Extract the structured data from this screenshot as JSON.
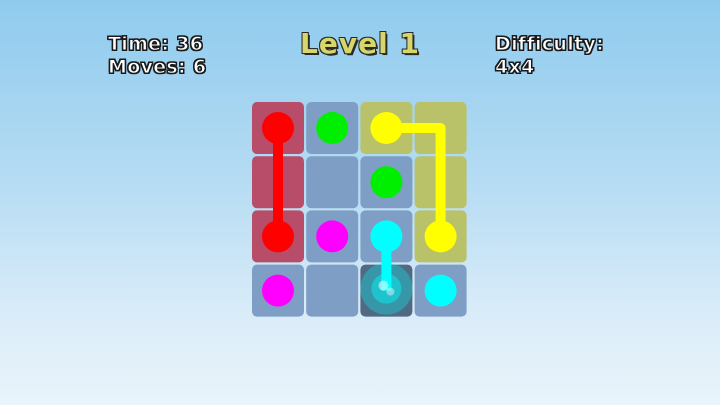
{
  "hud": {
    "time_text": "Time: 36",
    "moves_text": "Moves: 6",
    "level_text": "Level 1",
    "difficulty_label": "Difficulty:",
    "difficulty_value": "4x4"
  },
  "board": {
    "rows": 4,
    "cols": 4,
    "colors": {
      "red": "#ff0000",
      "green": "#00ee00",
      "yellow": "#ffff00",
      "magenta": "#ff00ff",
      "cyan": "#00ffff",
      "empty_cell": "#7f9ec6",
      "selected_cell": "#4f6a82"
    },
    "dots": [
      {
        "color": "red",
        "row": 0,
        "col": 0
      },
      {
        "color": "red",
        "row": 2,
        "col": 0
      },
      {
        "color": "green",
        "row": 0,
        "col": 1
      },
      {
        "color": "green",
        "row": 1,
        "col": 2
      },
      {
        "color": "yellow",
        "row": 0,
        "col": 2
      },
      {
        "color": "yellow",
        "row": 2,
        "col": 3
      },
      {
        "color": "magenta",
        "row": 2,
        "col": 1
      },
      {
        "color": "magenta",
        "row": 3,
        "col": 0
      },
      {
        "color": "cyan",
        "row": 2,
        "col": 2
      },
      {
        "color": "cyan",
        "row": 3,
        "col": 3
      }
    ],
    "paths": [
      {
        "color": "red",
        "cells": [
          [
            0,
            0
          ],
          [
            1,
            0
          ],
          [
            2,
            0
          ]
        ]
      },
      {
        "color": "yellow",
        "cells": [
          [
            0,
            2
          ],
          [
            0,
            3
          ],
          [
            1,
            3
          ],
          [
            2,
            3
          ]
        ]
      },
      {
        "color": "cyan",
        "cells": [
          [
            2,
            2
          ],
          [
            3,
            2
          ]
        ]
      }
    ],
    "selected_cell": {
      "row": 3,
      "col": 2
    },
    "cursor_color": "cyan"
  }
}
